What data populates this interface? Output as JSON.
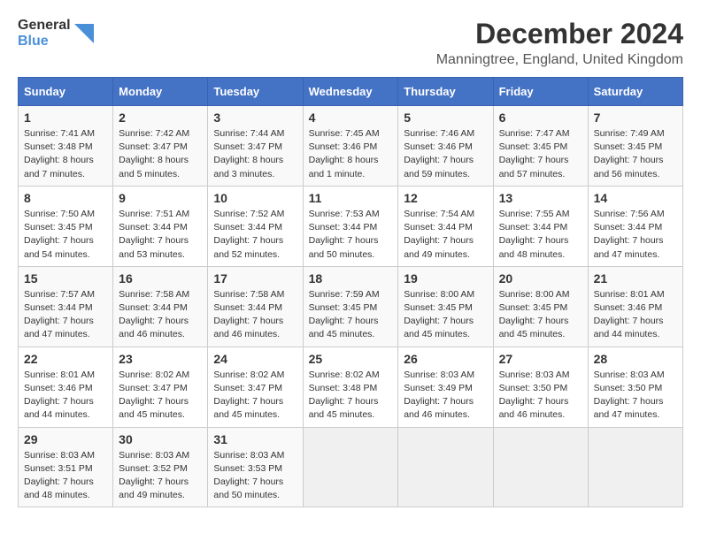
{
  "logo": {
    "general": "General",
    "blue": "Blue"
  },
  "title": "December 2024",
  "subtitle": "Manningtree, England, United Kingdom",
  "headers": [
    "Sunday",
    "Monday",
    "Tuesday",
    "Wednesday",
    "Thursday",
    "Friday",
    "Saturday"
  ],
  "weeks": [
    [
      {
        "day": "1",
        "sunrise": "Sunrise: 7:41 AM",
        "sunset": "Sunset: 3:48 PM",
        "daylight": "Daylight: 8 hours and 7 minutes."
      },
      {
        "day": "2",
        "sunrise": "Sunrise: 7:42 AM",
        "sunset": "Sunset: 3:47 PM",
        "daylight": "Daylight: 8 hours and 5 minutes."
      },
      {
        "day": "3",
        "sunrise": "Sunrise: 7:44 AM",
        "sunset": "Sunset: 3:47 PM",
        "daylight": "Daylight: 8 hours and 3 minutes."
      },
      {
        "day": "4",
        "sunrise": "Sunrise: 7:45 AM",
        "sunset": "Sunset: 3:46 PM",
        "daylight": "Daylight: 8 hours and 1 minute."
      },
      {
        "day": "5",
        "sunrise": "Sunrise: 7:46 AM",
        "sunset": "Sunset: 3:46 PM",
        "daylight": "Daylight: 7 hours and 59 minutes."
      },
      {
        "day": "6",
        "sunrise": "Sunrise: 7:47 AM",
        "sunset": "Sunset: 3:45 PM",
        "daylight": "Daylight: 7 hours and 57 minutes."
      },
      {
        "day": "7",
        "sunrise": "Sunrise: 7:49 AM",
        "sunset": "Sunset: 3:45 PM",
        "daylight": "Daylight: 7 hours and 56 minutes."
      }
    ],
    [
      {
        "day": "8",
        "sunrise": "Sunrise: 7:50 AM",
        "sunset": "Sunset: 3:45 PM",
        "daylight": "Daylight: 7 hours and 54 minutes."
      },
      {
        "day": "9",
        "sunrise": "Sunrise: 7:51 AM",
        "sunset": "Sunset: 3:44 PM",
        "daylight": "Daylight: 7 hours and 53 minutes."
      },
      {
        "day": "10",
        "sunrise": "Sunrise: 7:52 AM",
        "sunset": "Sunset: 3:44 PM",
        "daylight": "Daylight: 7 hours and 52 minutes."
      },
      {
        "day": "11",
        "sunrise": "Sunrise: 7:53 AM",
        "sunset": "Sunset: 3:44 PM",
        "daylight": "Daylight: 7 hours and 50 minutes."
      },
      {
        "day": "12",
        "sunrise": "Sunrise: 7:54 AM",
        "sunset": "Sunset: 3:44 PM",
        "daylight": "Daylight: 7 hours and 49 minutes."
      },
      {
        "day": "13",
        "sunrise": "Sunrise: 7:55 AM",
        "sunset": "Sunset: 3:44 PM",
        "daylight": "Daylight: 7 hours and 48 minutes."
      },
      {
        "day": "14",
        "sunrise": "Sunrise: 7:56 AM",
        "sunset": "Sunset: 3:44 PM",
        "daylight": "Daylight: 7 hours and 47 minutes."
      }
    ],
    [
      {
        "day": "15",
        "sunrise": "Sunrise: 7:57 AM",
        "sunset": "Sunset: 3:44 PM",
        "daylight": "Daylight: 7 hours and 47 minutes."
      },
      {
        "day": "16",
        "sunrise": "Sunrise: 7:58 AM",
        "sunset": "Sunset: 3:44 PM",
        "daylight": "Daylight: 7 hours and 46 minutes."
      },
      {
        "day": "17",
        "sunrise": "Sunrise: 7:58 AM",
        "sunset": "Sunset: 3:44 PM",
        "daylight": "Daylight: 7 hours and 46 minutes."
      },
      {
        "day": "18",
        "sunrise": "Sunrise: 7:59 AM",
        "sunset": "Sunset: 3:45 PM",
        "daylight": "Daylight: 7 hours and 45 minutes."
      },
      {
        "day": "19",
        "sunrise": "Sunrise: 8:00 AM",
        "sunset": "Sunset: 3:45 PM",
        "daylight": "Daylight: 7 hours and 45 minutes."
      },
      {
        "day": "20",
        "sunrise": "Sunrise: 8:00 AM",
        "sunset": "Sunset: 3:45 PM",
        "daylight": "Daylight: 7 hours and 45 minutes."
      },
      {
        "day": "21",
        "sunrise": "Sunrise: 8:01 AM",
        "sunset": "Sunset: 3:46 PM",
        "daylight": "Daylight: 7 hours and 44 minutes."
      }
    ],
    [
      {
        "day": "22",
        "sunrise": "Sunrise: 8:01 AM",
        "sunset": "Sunset: 3:46 PM",
        "daylight": "Daylight: 7 hours and 44 minutes."
      },
      {
        "day": "23",
        "sunrise": "Sunrise: 8:02 AM",
        "sunset": "Sunset: 3:47 PM",
        "daylight": "Daylight: 7 hours and 45 minutes."
      },
      {
        "day": "24",
        "sunrise": "Sunrise: 8:02 AM",
        "sunset": "Sunset: 3:47 PM",
        "daylight": "Daylight: 7 hours and 45 minutes."
      },
      {
        "day": "25",
        "sunrise": "Sunrise: 8:02 AM",
        "sunset": "Sunset: 3:48 PM",
        "daylight": "Daylight: 7 hours and 45 minutes."
      },
      {
        "day": "26",
        "sunrise": "Sunrise: 8:03 AM",
        "sunset": "Sunset: 3:49 PM",
        "daylight": "Daylight: 7 hours and 46 minutes."
      },
      {
        "day": "27",
        "sunrise": "Sunrise: 8:03 AM",
        "sunset": "Sunset: 3:50 PM",
        "daylight": "Daylight: 7 hours and 46 minutes."
      },
      {
        "day": "28",
        "sunrise": "Sunrise: 8:03 AM",
        "sunset": "Sunset: 3:50 PM",
        "daylight": "Daylight: 7 hours and 47 minutes."
      }
    ],
    [
      {
        "day": "29",
        "sunrise": "Sunrise: 8:03 AM",
        "sunset": "Sunset: 3:51 PM",
        "daylight": "Daylight: 7 hours and 48 minutes."
      },
      {
        "day": "30",
        "sunrise": "Sunrise: 8:03 AM",
        "sunset": "Sunset: 3:52 PM",
        "daylight": "Daylight: 7 hours and 49 minutes."
      },
      {
        "day": "31",
        "sunrise": "Sunrise: 8:03 AM",
        "sunset": "Sunset: 3:53 PM",
        "daylight": "Daylight: 7 hours and 50 minutes."
      },
      null,
      null,
      null,
      null
    ]
  ]
}
